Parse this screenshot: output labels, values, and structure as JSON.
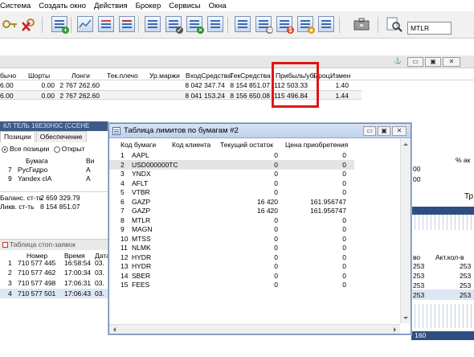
{
  "menu": [
    "Система",
    "Создать окно",
    "Действия",
    "Брокер",
    "Сервисы",
    "Окна"
  ],
  "toolbar": {
    "ticker_value": "MTLR",
    "icons": [
      "key-icon",
      "disconnect-icon",
      "new-table-icon",
      "chart-icon",
      "quotes-icon",
      "orders-icon",
      "transactions-icon",
      "limits-icon",
      "export-icon",
      "positions-icon",
      "trades-icon",
      "portfolio-icon",
      "money-icon",
      "coins-icon",
      "list-icon",
      "briefcase-icon",
      "search-icon"
    ]
  },
  "top_table": {
    "headers": [
      "бычо",
      "Шорты",
      "Лонги",
      "Тек.плечо",
      "Ур.маржи",
      "ВходСредства",
      "ТекСредства",
      "Прибыль/убы",
      "Проц.",
      "Измен"
    ],
    "rows": [
      [
        "6.00",
        "0.00",
        "2 767 262.60",
        "",
        "",
        "8 042 347.74",
        "8 154 851.07",
        "112 503.33",
        "",
        "1.40"
      ],
      [
        "6.00",
        "0.00",
        "2 767 262.60",
        "",
        "",
        "8 041 153.24",
        "8 156 650.08",
        "115 496.84",
        "",
        "1.44"
      ]
    ]
  },
  "positions_panel": {
    "bar_title": "КЛ ТЕЛЬ 16ЕЗ0Н0С (ССЕНЕ",
    "tabs": [
      "Позиции",
      "Обеспечение"
    ],
    "radio_all": "Все позиции",
    "radio_open": "Открыт",
    "col_stock": "Бумага",
    "col_vi": "Ви",
    "rows": [
      {
        "num": "7",
        "name": "РусГидро",
        "v": "A"
      },
      {
        "num": "9",
        "name": "Yandex clA",
        "v": "A"
      }
    ],
    "balance_label": "Баланс. ст-ть",
    "balance_value": "2 659 329.79",
    "liq_label": "Ликв. ст-ть",
    "liq_value": "8 154 851.07"
  },
  "stop_panel": {
    "title": "Таблица стоп-заявок",
    "headers": [
      "Номер",
      "Время",
      "Дата"
    ],
    "rows": [
      {
        "n": "1",
        "num": "710 577 445",
        "time": "16:58:54",
        "date": "03."
      },
      {
        "n": "2",
        "num": "710 577 462",
        "time": "17:00:34",
        "date": "03."
      },
      {
        "n": "3",
        "num": "710 577 498",
        "time": "17:06:31",
        "date": "03."
      },
      {
        "n": "4",
        "num": "710 577 501",
        "time": "17:06:43",
        "date": "03."
      }
    ]
  },
  "right_panel": {
    "header_pct": "% ак",
    "val_00a": "00",
    "val_00b": "00",
    "tr_label": "Тр",
    "col_vo": "во",
    "col_akt": "Акт.кол-в",
    "rows": [
      [
        "253",
        "253"
      ],
      [
        "253",
        "253"
      ],
      [
        "253",
        "253"
      ],
      [
        "253",
        "253"
      ]
    ],
    "footer_value": "160"
  },
  "dialog": {
    "title": "Таблица лимитов по бумагам #2",
    "headers": [
      "Код бумаги",
      "Код клиента",
      "Текущий остаток",
      "Цена приобретения"
    ],
    "rows": [
      {
        "n": "1",
        "code": "AAPL",
        "rest": "0",
        "price": "0"
      },
      {
        "n": "2",
        "code": "USD000000TC",
        "rest": "0",
        "price": "0"
      },
      {
        "n": "3",
        "code": "YNDX",
        "rest": "0",
        "price": "0"
      },
      {
        "n": "4",
        "code": "AFLT",
        "rest": "0",
        "price": "0"
      },
      {
        "n": "5",
        "code": "VTBR",
        "rest": "0",
        "price": "0"
      },
      {
        "n": "6",
        "code": "GAZP",
        "rest": "16 420",
        "price": "161.956747"
      },
      {
        "n": "7",
        "code": "GAZP",
        "rest": "16 420",
        "price": "161.956747"
      },
      {
        "n": "8",
        "code": "MTLR",
        "rest": "0",
        "price": "0"
      },
      {
        "n": "9",
        "code": "MAGN",
        "rest": "0",
        "price": "0"
      },
      {
        "n": "10",
        "code": "MTSS",
        "rest": "0",
        "price": "0"
      },
      {
        "n": "11",
        "code": "NLMK",
        "rest": "0",
        "price": "0"
      },
      {
        "n": "12",
        "code": "HYDR",
        "rest": "0",
        "price": "0"
      },
      {
        "n": "13",
        "code": "HYDR",
        "rest": "0",
        "price": "0"
      },
      {
        "n": "14",
        "code": "SBER",
        "rest": "0",
        "price": "0"
      },
      {
        "n": "15",
        "code": "FEES",
        "rest": "0",
        "price": "0"
      }
    ]
  }
}
